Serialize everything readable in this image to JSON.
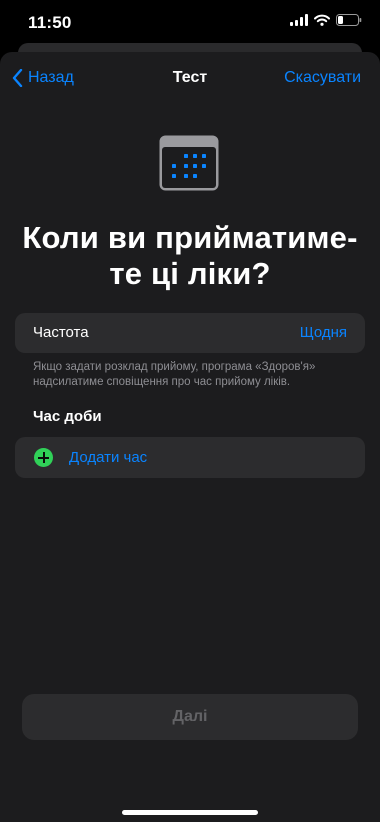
{
  "status_bar": {
    "time": "11:50"
  },
  "nav": {
    "back_label": "Назад",
    "title": "Тест",
    "cancel_label": "Скасувати"
  },
  "heading": "Коли ви прийматиме-те ці ліки?",
  "frequency": {
    "label": "Частота",
    "value": "Щодня"
  },
  "hint": "Якщо задати розклад прийому, програма «Здоров'я» надсилатиме сповіщення про час прийому ліків.",
  "time_of_day": {
    "title": "Час доби",
    "add_label": "Додати час"
  },
  "next_label": "Далі",
  "colors": {
    "accent": "#0a84ff",
    "add_icon": "#30d158",
    "sheet_bg": "#1c1c1e",
    "card_bg": "#2c2c2e"
  },
  "icons": [
    "chevron-left-icon",
    "calendar-icon",
    "plus-circle-icon",
    "signal-icon",
    "wifi-icon",
    "battery-icon"
  ]
}
